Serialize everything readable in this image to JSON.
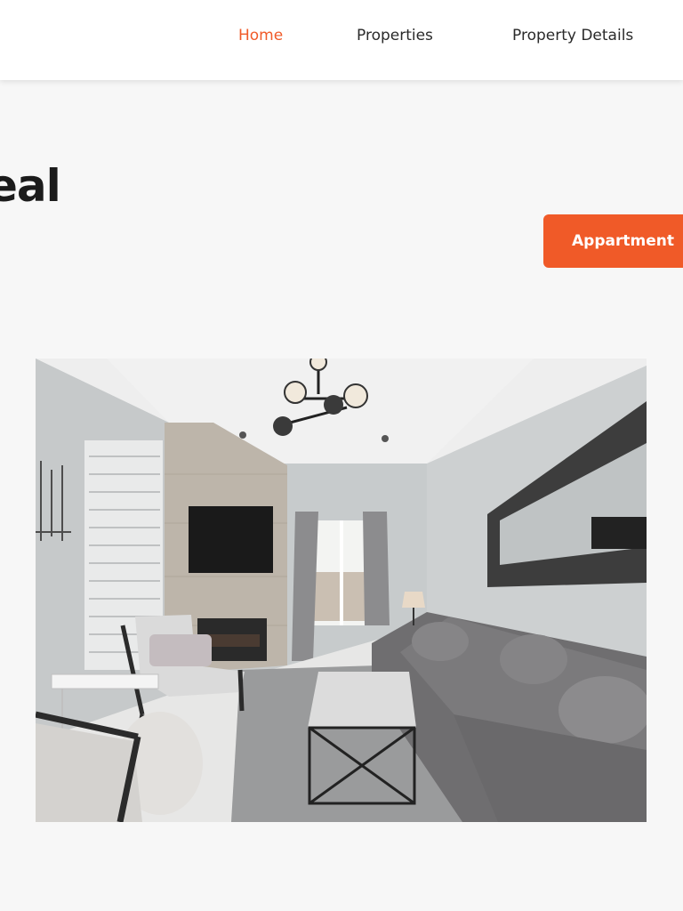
{
  "nav": {
    "items": [
      {
        "label": "Home",
        "active": true
      },
      {
        "label": "Properties",
        "active": false
      },
      {
        "label": "Property Details",
        "active": false
      }
    ]
  },
  "hero": {
    "headline_visible_fragment": "eal",
    "cta_label": "Appartment"
  },
  "colors": {
    "accent": "#f05a28",
    "text": "#1b1b1b",
    "nav_text": "#2a2a2a",
    "background": "#f7f7f7"
  },
  "image": {
    "subject": "living-room-interior-photo"
  }
}
